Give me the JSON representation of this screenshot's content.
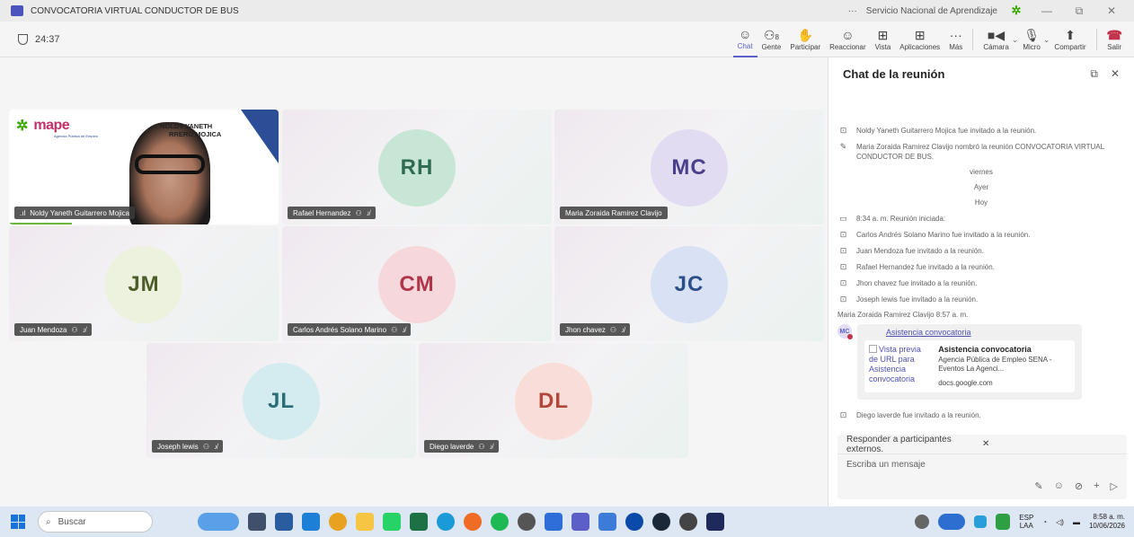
{
  "window": {
    "title": "CONVOCATORIA VIRTUAL CONDUCTOR DE BUS",
    "org": "Servicio Nacional de Aprendizaje",
    "more": "···",
    "minimize": "—",
    "restore": "⧉",
    "close": "✕"
  },
  "toolbar": {
    "timer": "24:37",
    "chat": "Chat",
    "people": "Gente",
    "people_count": "8",
    "raise": "Participar",
    "react": "Reaccionar",
    "view": "Vista",
    "apps": "Aplicaciones",
    "more": "Más",
    "camera": "Cámara",
    "mic": "Micro",
    "share": "Compartir",
    "leave": "Salir"
  },
  "tiles": [
    {
      "name": "Noldy Yaneth Guitarrero Mojica",
      "type": "video"
    },
    {
      "name": "Rafael Hernandez",
      "initials": "RH",
      "color": "#c8e6d6",
      "text_color": "#2e6b4f"
    },
    {
      "name": "Maria Zoraida Ramirez Clavijo",
      "initials": "MC",
      "color": "#e2dcf2",
      "text_color": "#4a3f8a"
    },
    {
      "name": "Juan Mendoza",
      "initials": "JM",
      "color": "#ecf2dd",
      "text_color": "#4d5d2a"
    },
    {
      "name": "Carlos Andrés Solano Marino",
      "initials": "CM",
      "color": "#f6d7db",
      "text_color": "#b03549"
    },
    {
      "name": "Jhon chavez",
      "initials": "JC",
      "color": "#d8e2f4",
      "text_color": "#2c4f8a"
    },
    {
      "name": "Joseph lewis",
      "initials": "JL",
      "color": "#d4ecef",
      "text_color": "#2a6d76"
    },
    {
      "name": "Diego laverde",
      "initials": "DL",
      "color": "#f8ddd8",
      "text_color": "#b0473a"
    }
  ],
  "video": {
    "banner_name_1": "NOLDY YANETH",
    "banner_name_2": "RRERO MOJICA",
    "logo_text": "mape",
    "logo_sub": "Agencia Pública de Empleo"
  },
  "chat": {
    "title": "Chat de la reunión",
    "events": [
      {
        "icon": "invite",
        "text": "Noldy Yaneth Guitarrero Mojica fue invitado a la reunión."
      },
      {
        "icon": "pencil",
        "text": "Maria Zoraida Ramirez Clavijo nombró la reunión CONVOCATORIA VIRTUAL CONDUCTOR DE BUS."
      }
    ],
    "date_friday": "viernes",
    "date_yesterday": "Ayer",
    "date_today": "Hoy",
    "events2": [
      {
        "icon": "meeting",
        "text": "8:34 a. m.   Reunión iniciada:"
      },
      {
        "icon": "invite",
        "text": "Carlos Andrés Solano Marino  fue invitado a la reunión."
      },
      {
        "icon": "invite",
        "text": "Juan Mendoza  fue invitado a la reunión."
      },
      {
        "icon": "invite",
        "text": "Rafael Hernandez  fue invitado a la reunión."
      },
      {
        "icon": "invite",
        "text": "Jhon chavez   fue invitado a la reunión."
      },
      {
        "icon": "invite",
        "text": "Joseph lewis  fue invitado a la reunión."
      }
    ],
    "message": {
      "author_time": "Maria Zoraida Ramirez Clavijo  8:57 a. m.",
      "avatar": "MC",
      "link": "Asistencia convocatoria",
      "preview_alt": "Vista previa de URL para Asistencia convocatoria",
      "card_title": "Asistencia convocatoria",
      "card_desc": "Agencia Pública de Empleo SENA - Eventos La Agenci...",
      "card_domain": "docs.google.com"
    },
    "last_event": "Diego laverde  fue invitado a la reunión.",
    "reply_banner": "Responder a participantes externos.",
    "input_placeholder": "Escriba un mensaje"
  },
  "taskbar": {
    "search": "Buscar",
    "lang_1": "ESP",
    "lang_2": "LAA",
    "time": "8:58 a. m.",
    "date": "10/06/2026"
  },
  "colors": {
    "accent": "#5b5fc7",
    "leave": "#c4314b",
    "sena_green": "#39a900"
  }
}
